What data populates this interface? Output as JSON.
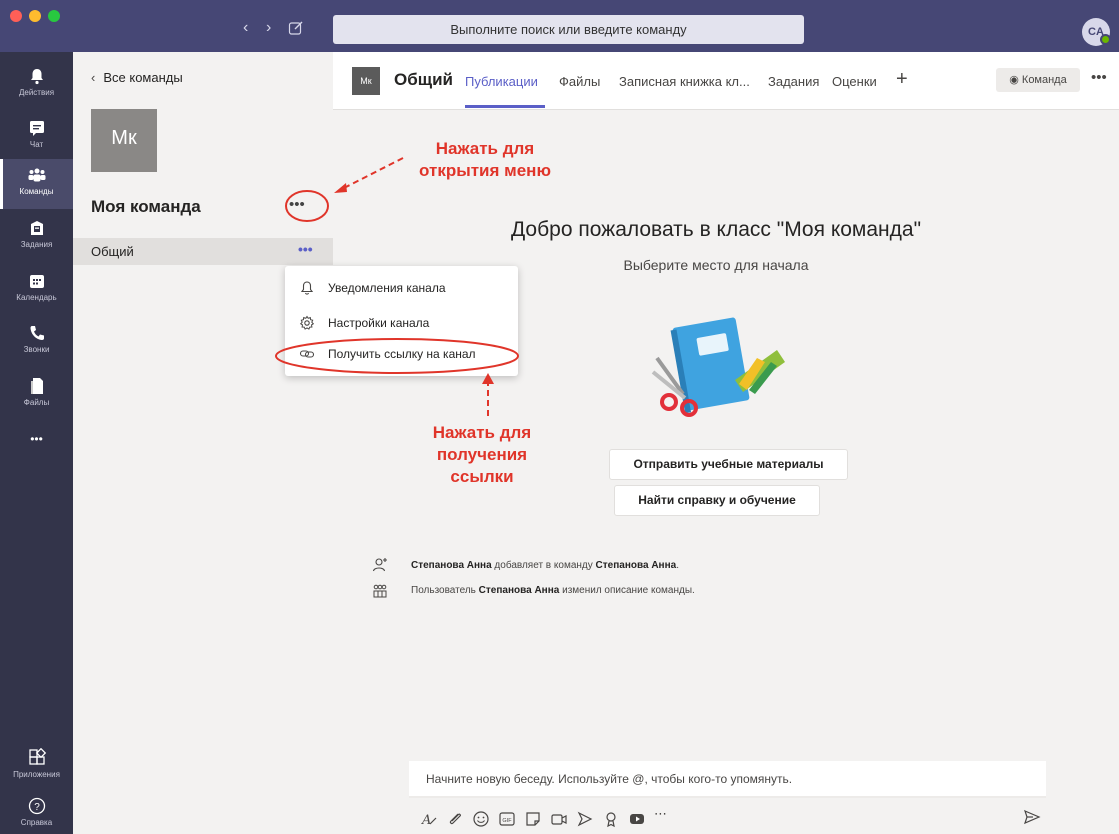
{
  "search": {
    "placeholder": "Выполните поиск или введите команду"
  },
  "user": {
    "initials": "CA"
  },
  "rail": {
    "items": [
      {
        "label": "Действия",
        "icon": "bell-icon"
      },
      {
        "label": "Чат",
        "icon": "chat-icon"
      },
      {
        "label": "Команды",
        "icon": "teams-icon",
        "active": true
      },
      {
        "label": "Задания",
        "icon": "assignments-icon"
      },
      {
        "label": "Календарь",
        "icon": "calendar-icon"
      },
      {
        "label": "Звонки",
        "icon": "phone-icon"
      },
      {
        "label": "Файлы",
        "icon": "files-icon"
      }
    ],
    "more": "•••",
    "apps_label": "Приложения",
    "help_label": "Справка"
  },
  "team_panel": {
    "back_label": "Все команды",
    "team_initials": "Мк",
    "team_name": "Моя команда",
    "more": "•••",
    "channels": [
      {
        "name": "Общий",
        "more": "•••"
      }
    ]
  },
  "channel_header": {
    "initials": "Мк",
    "title": "Общий",
    "tabs": [
      "Публикации",
      "Файлы",
      "Записная книжка кл...",
      "Задания",
      "Оценки"
    ],
    "plus": "+",
    "team_button": "Команда",
    "more": "•••"
  },
  "welcome": {
    "title": "Добро пожаловать в класс \"Моя команда\"",
    "subtitle": "Выберите место для начала",
    "buttons": [
      "Отправить учебные материалы",
      "Найти справку и обучение"
    ]
  },
  "activity": [
    {
      "bold1": "Степанова Анна",
      "text1": " добавляет в команду ",
      "bold2": "Степанова Анна",
      "text2": "."
    },
    {
      "pre": "Пользователь ",
      "bold": "Степанова Анна",
      "text": " изменил описание команды."
    }
  ],
  "compose": {
    "placeholder": "Начните новую беседу. Используйте @, чтобы кого-то упомянуть."
  },
  "context_menu": {
    "items": [
      {
        "label": "Уведомления канала",
        "icon": "bell-icon"
      },
      {
        "label": "Настройки канала",
        "icon": "gear-icon"
      },
      {
        "label": "Получить ссылку на канал",
        "icon": "link-icon"
      }
    ]
  },
  "annotations": {
    "menu_hint": [
      "Нажать для",
      "открытия меню"
    ],
    "link_hint": [
      "Нажать для",
      "получения",
      "ссылки"
    ],
    "color": "#e0352a"
  },
  "colors": {
    "accent": "#5b5fc7",
    "titlebar": "#464775",
    "rail": "#33344a"
  }
}
